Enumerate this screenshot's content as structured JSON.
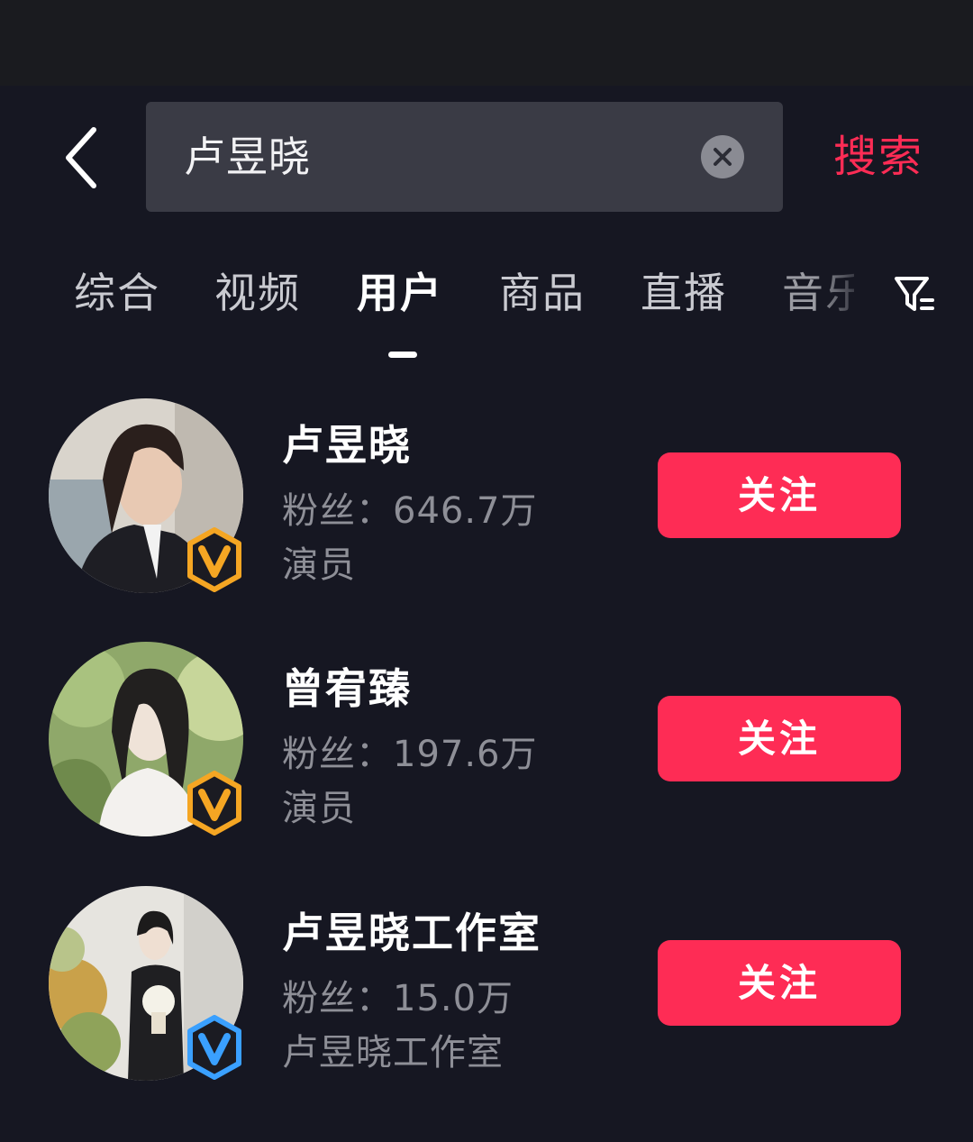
{
  "header": {
    "back_icon": "chevron-left-icon",
    "search_value": "卢昱晓",
    "clear_icon": "close-circle-icon",
    "search_label": "搜索"
  },
  "tabs": [
    {
      "label": "综合",
      "active": false
    },
    {
      "label": "视频",
      "active": false
    },
    {
      "label": "用户",
      "active": true
    },
    {
      "label": "商品",
      "active": false
    },
    {
      "label": "直播",
      "active": false
    },
    {
      "label": "音乐",
      "active": false
    }
  ],
  "filter_icon": "filter-icon",
  "users": [
    {
      "name": "卢昱晓",
      "fans": "粉丝：646.7万",
      "desc": "演员",
      "follow_label": "关注",
      "badge": "gold-v-badge"
    },
    {
      "name": "曾宥臻",
      "fans": "粉丝：197.6万",
      "desc": "演员",
      "follow_label": "关注",
      "badge": "gold-v-badge"
    },
    {
      "name": "卢昱晓工作室",
      "fans": "粉丝：15.0万",
      "desc": "卢昱晓工作室",
      "follow_label": "关注",
      "badge": "blue-v-badge"
    }
  ],
  "colors": {
    "background": "#161722",
    "accent": "#fe2c55",
    "badge_gold": "#f5a623",
    "badge_blue": "#3aa0ff"
  }
}
